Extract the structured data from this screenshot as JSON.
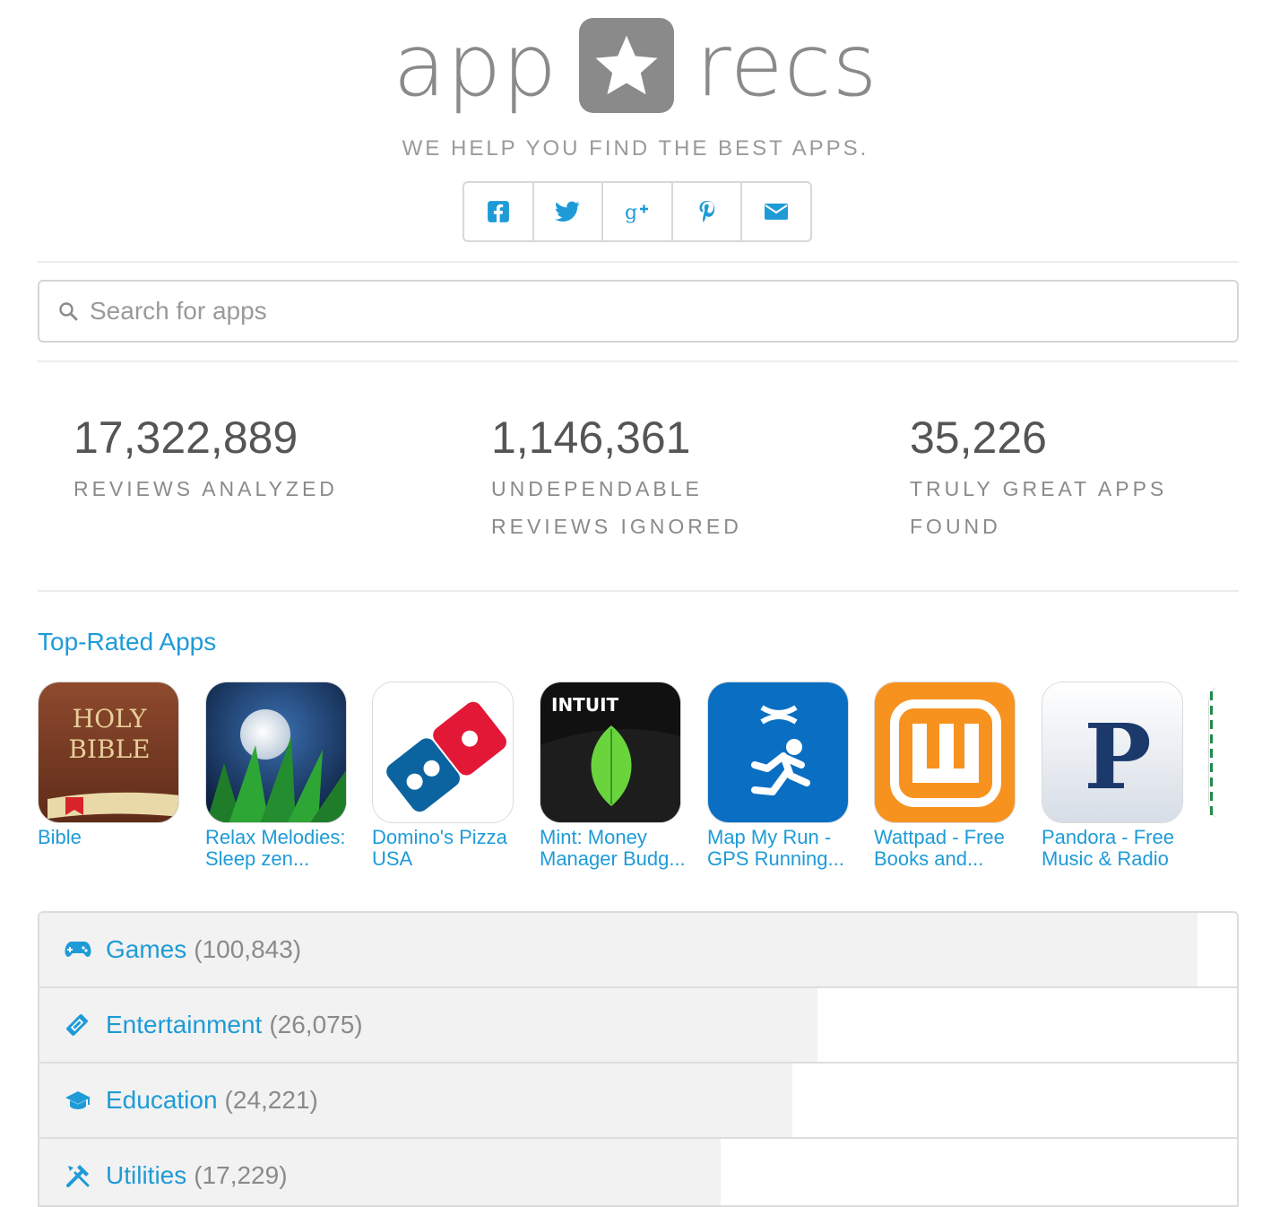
{
  "logo": {
    "left": "app",
    "right": "recs"
  },
  "tagline": "WE HELP YOU FIND THE BEST APPS.",
  "share": [
    {
      "icon": "facebook-icon"
    },
    {
      "icon": "twitter-icon"
    },
    {
      "icon": "google-plus-icon"
    },
    {
      "icon": "pinterest-icon"
    },
    {
      "icon": "email-icon"
    }
  ],
  "search": {
    "placeholder": "Search for apps",
    "value": ""
  },
  "stats": [
    {
      "number": "17,322,889",
      "label": "REVIEWS ANALYZED"
    },
    {
      "number": "1,146,361",
      "label": "UNDEPENDABLE REVIEWS IGNORED"
    },
    {
      "number": "35,226",
      "label": "TRULY GREAT APPS FOUND"
    }
  ],
  "top_rated": {
    "title": "Top-Rated Apps",
    "apps": [
      {
        "name": "Bible"
      },
      {
        "name": "Relax Melodies: Sleep zen..."
      },
      {
        "name": "Domino's Pizza USA"
      },
      {
        "name": "Mint: Money Manager Budg..."
      },
      {
        "name": "Map My Run - GPS Running..."
      },
      {
        "name": "Wattpad - Free Books and..."
      },
      {
        "name": "Pandora - Free Music & Radio"
      }
    ],
    "icon_text": {
      "bible_line1": "HOLY",
      "bible_line2": "BIBLE",
      "mint_brand": "INTUIT",
      "pandora_letter": "P"
    }
  },
  "categories": [
    {
      "label": "Games",
      "count": "(100,843)",
      "share": 0.967,
      "icon": "gamepad-icon"
    },
    {
      "label": "Entertainment",
      "count": "(26,075)",
      "share": 0.65,
      "icon": "ticket-icon"
    },
    {
      "label": "Education",
      "count": "(24,221)",
      "share": 0.629,
      "icon": "graduation-cap-icon"
    },
    {
      "label": "Utilities",
      "count": "(17,229)",
      "share": 0.569,
      "icon": "tools-icon"
    }
  ],
  "colors": {
    "accent": "#1e9bd7",
    "logo_gray": "#8a8a8a",
    "bar_fill": "#f2f2f2"
  }
}
